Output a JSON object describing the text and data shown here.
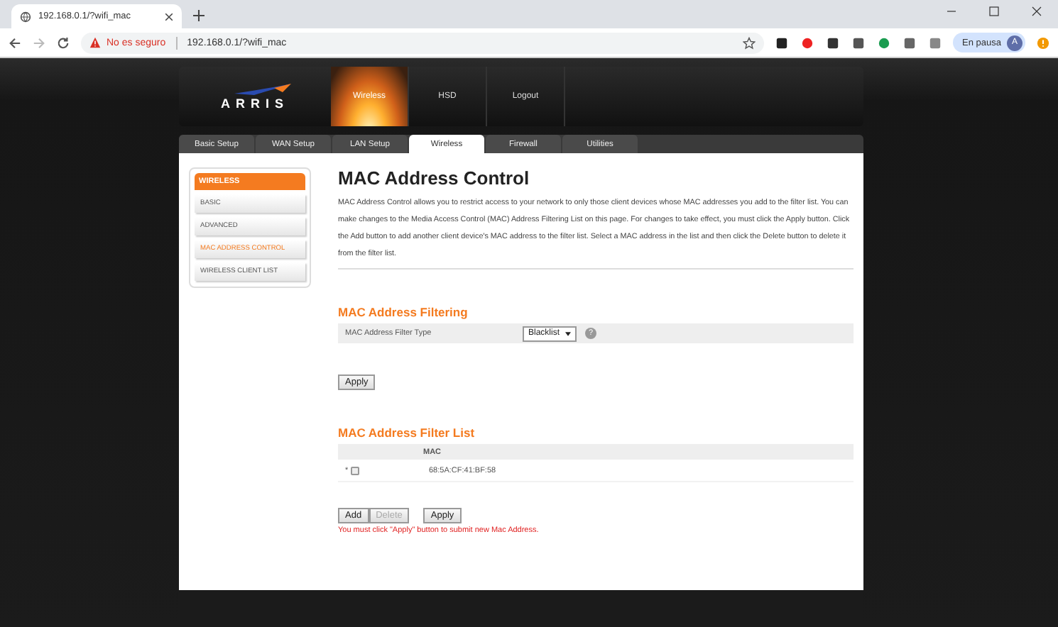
{
  "browser": {
    "tab_title": "192.168.0.1/?wifi_mac",
    "security_label": "No es seguro",
    "url": "192.168.0.1/?wifi_mac",
    "profile_status": "En pausa",
    "avatar_letter": "A"
  },
  "router": {
    "logo": "ARRIS",
    "top_nav": [
      {
        "label": "Wireless",
        "selected": true
      },
      {
        "label": "HSD",
        "selected": false
      },
      {
        "label": "Logout",
        "selected": false
      }
    ],
    "tabs": [
      {
        "label": "Basic Setup",
        "selected": false
      },
      {
        "label": "WAN Setup",
        "selected": false
      },
      {
        "label": "LAN Setup",
        "selected": false
      },
      {
        "label": "Wireless",
        "selected": true
      },
      {
        "label": "Firewall",
        "selected": false
      },
      {
        "label": "Utilities",
        "selected": false
      }
    ],
    "sidebar": {
      "title": "WIRELESS",
      "items": [
        {
          "label": "BASIC",
          "selected": false
        },
        {
          "label": "ADVANCED",
          "selected": false
        },
        {
          "label": "MAC ADDRESS CONTROL",
          "selected": true
        },
        {
          "label": "WIRELESS CLIENT LIST",
          "selected": false
        }
      ]
    },
    "main": {
      "title": "MAC Address Control",
      "description": "MAC Address Control allows you to restrict access to your network to only those client devices whose MAC addresses you add to the filter list. You can make changes to the Media Access Control (MAC) Address Filtering List on this page. For changes to take effect, you must click the Apply button. Click the Add button to add another client device's MAC address to the filter list. Select a MAC address in the list and then click the Delete button to delete it from the filter list.",
      "filtering": {
        "heading": "MAC Address Filtering",
        "label": "MAC Address Filter Type",
        "value": "Blacklist",
        "help": "?",
        "apply": "Apply"
      },
      "filter_list": {
        "heading": "MAC Address Filter List",
        "column": "MAC",
        "rows": [
          {
            "marker": "*",
            "checked": false,
            "mac": "68:5A:CF:41:BF:58"
          }
        ]
      },
      "buttons": [
        {
          "label": "Add",
          "disabled": false
        },
        {
          "label": "Delete",
          "disabled": true
        }
      ],
      "apply": "Apply",
      "note": "You must click \"Apply\" button to submit new Mac Address."
    }
  }
}
